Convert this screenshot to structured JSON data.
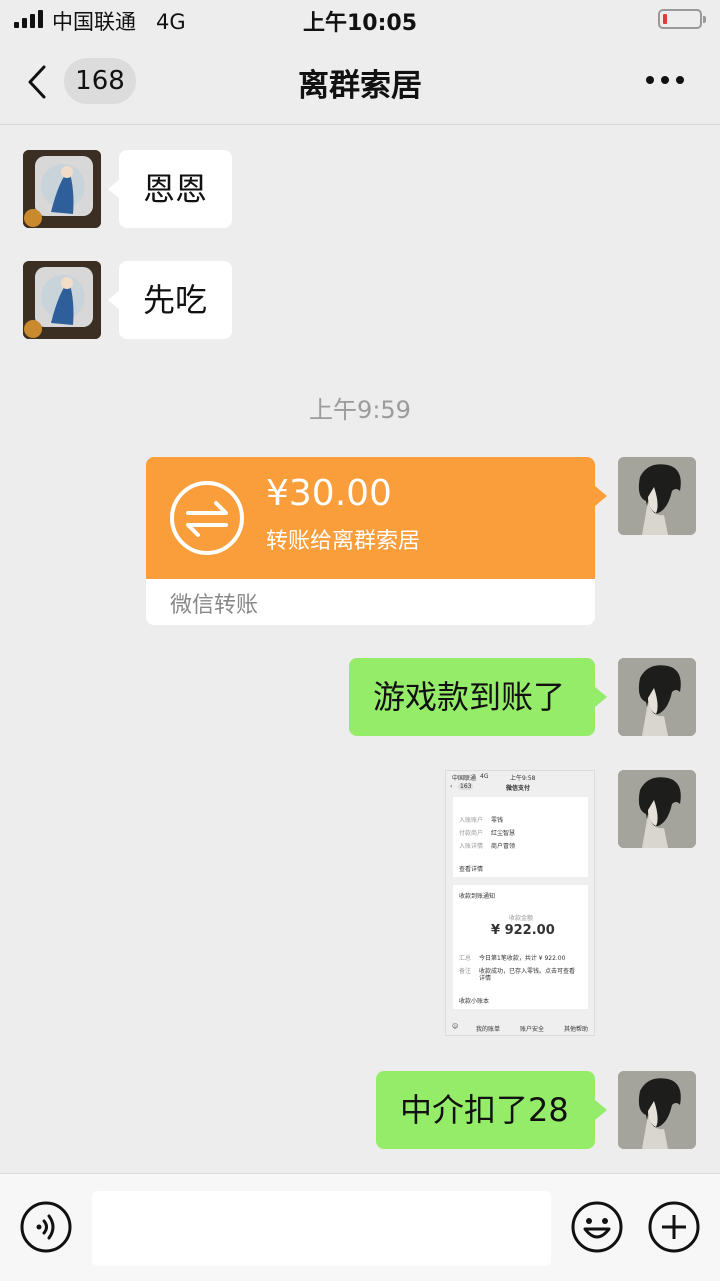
{
  "status_bar": {
    "carrier": "中国联通",
    "network": "4G",
    "time": "上午10:05"
  },
  "nav": {
    "badge_count": "168",
    "title": "离群索居"
  },
  "messages": {
    "m1": "恩恩",
    "m2": "先吃",
    "timestamp": "上午9:59",
    "transfer": {
      "amount": "¥30.00",
      "subtitle": "转账给离群索居",
      "footer": "微信转账"
    },
    "m3": "游戏款到账了",
    "m4": "中介扣了28"
  },
  "screenshot": {
    "status_carrier": "中国联通",
    "status_net": "4G",
    "status_time": "上午9:58",
    "badge": "163",
    "title": "微信支付",
    "info_rows": [
      {
        "label": "入账账户",
        "value": "零钱"
      },
      {
        "label": "付款商户",
        "value": "红尘智慧"
      },
      {
        "label": "入账详情",
        "value": "商户冒领"
      }
    ],
    "view_details": "查看详情",
    "notice_title": "收款到账通知",
    "amount_label": "收款金额",
    "amount": "¥ 922.00",
    "summary_label": "汇总",
    "summary_text": "今日第1笔收款，共计 ¥ 922.00",
    "note_label": "备注",
    "note_text_1": "收款成功，已存入零钱。点击可查看",
    "note_text_2": "详情",
    "ledger": "收款小账本",
    "tabs": [
      "我的账单",
      "账户安全",
      "其他帮助"
    ]
  },
  "colors": {
    "green_bubble": "#95ec69",
    "transfer_orange": "#fa9d3b",
    "background": "#ededed"
  }
}
